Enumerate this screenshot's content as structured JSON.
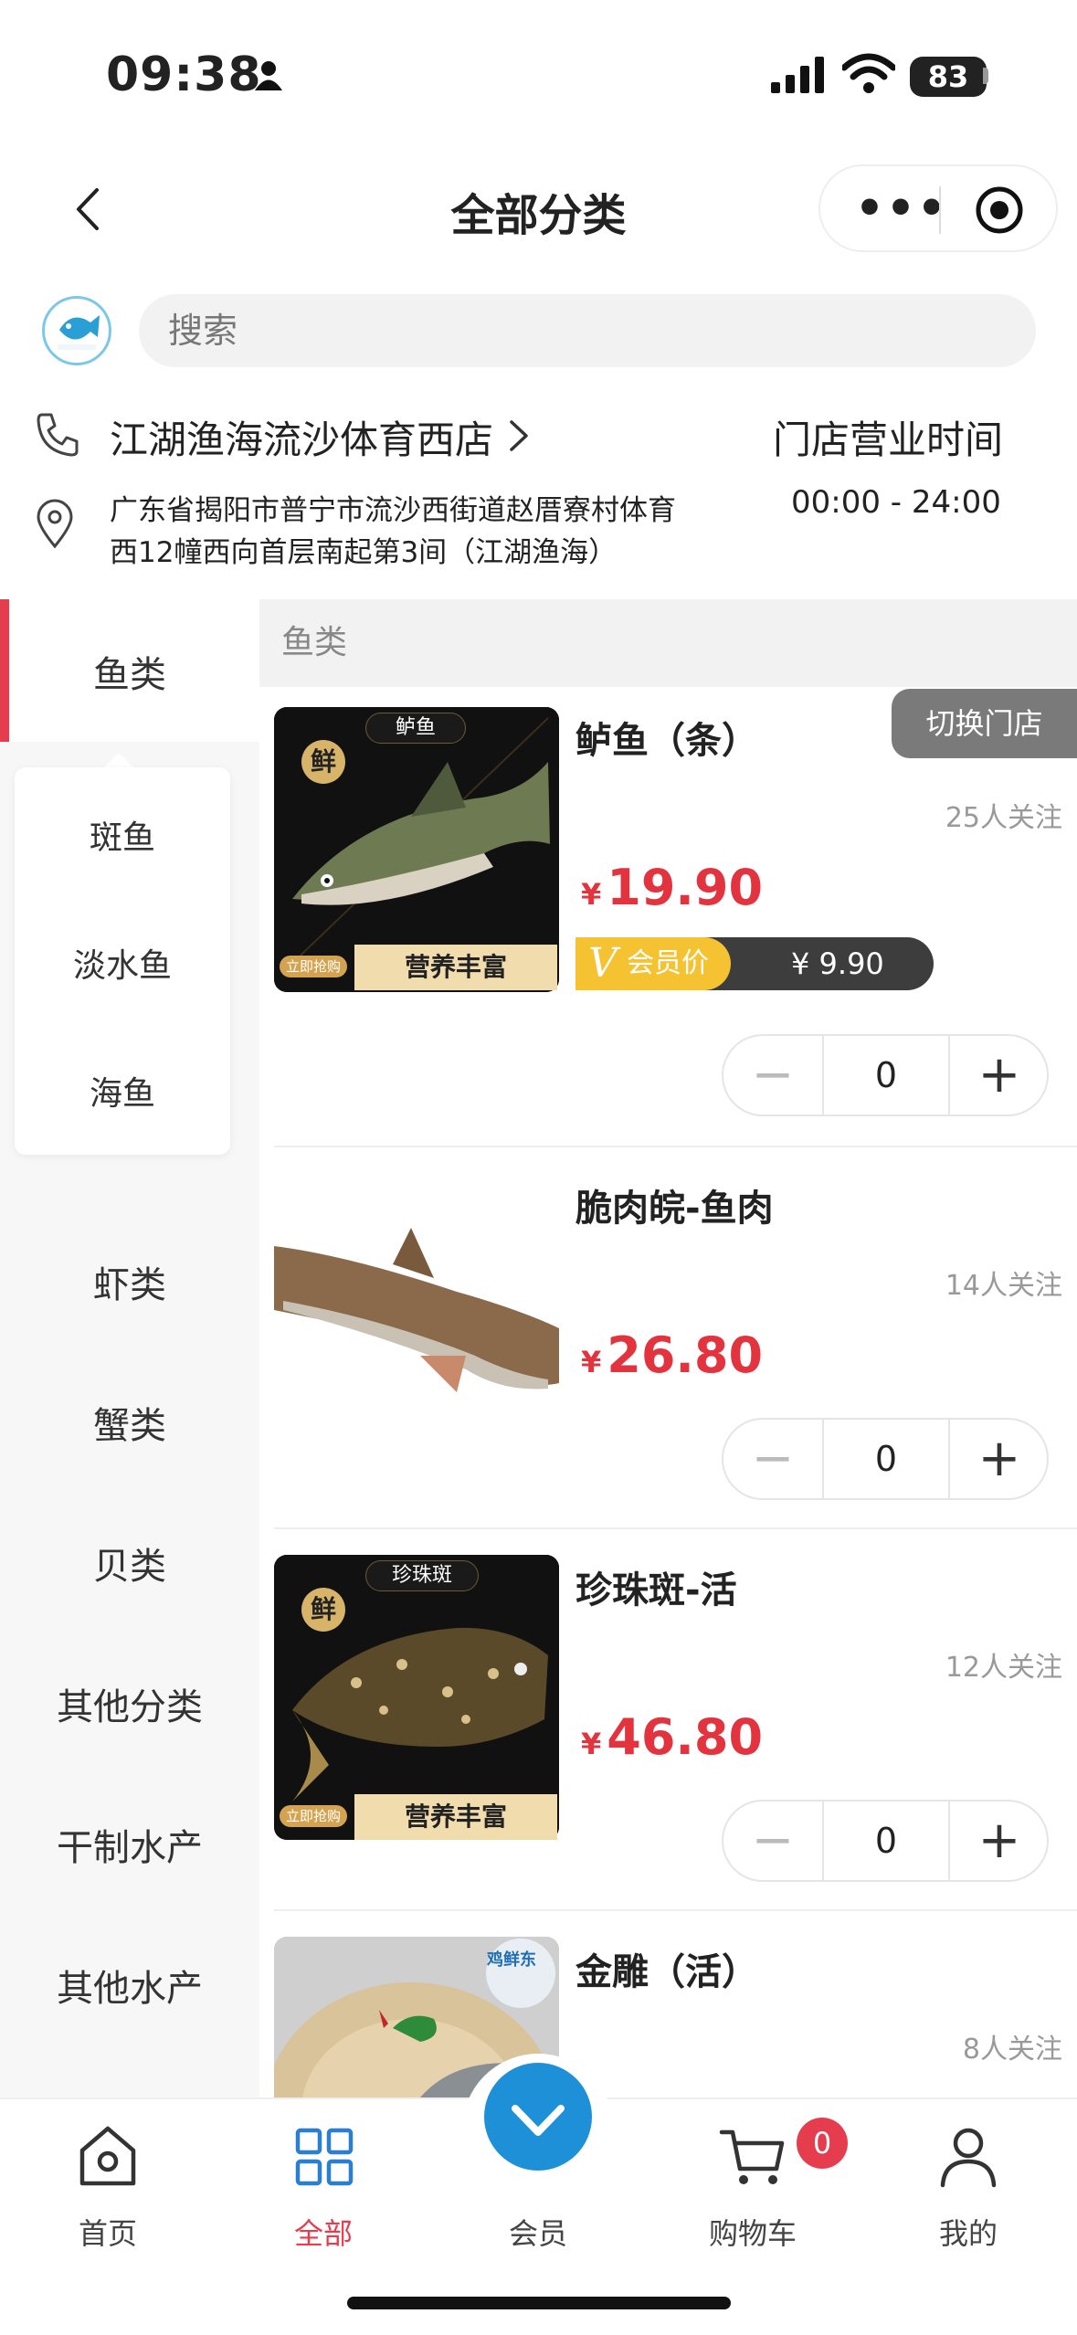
{
  "status": {
    "time": "09:38",
    "battery": "83"
  },
  "nav": {
    "title": "全部分类",
    "more_label": "•••"
  },
  "search": {
    "placeholder": "搜索"
  },
  "store": {
    "name": "江湖渔海流沙体育西店",
    "hours_label": "门店营业时间",
    "hours": "00:00 - 24:00",
    "address": "广东省揭阳市普宁市流沙西街道赵厝寮村体育西12幢西向首层南起第3间（江湖渔海）",
    "switch_label": "切换门店",
    "logo_text": "江湖渔海"
  },
  "sidebar": {
    "active": "鱼类",
    "sub_items": [
      "斑鱼",
      "淡水鱼",
      "海鱼"
    ],
    "items": [
      "虾类",
      "蟹类",
      "贝类",
      "其他分类",
      "干制水产",
      "其他水产"
    ]
  },
  "category_header": "鱼类",
  "products": [
    {
      "name": "鲈鱼（条）",
      "follow": "25人关注",
      "currency": "¥",
      "price": "19.90",
      "quantity": "0",
      "badge_fresh": "鲜",
      "img_tag": "鲈鱼",
      "img_banner": "营养丰富",
      "img_grab": "立即抢购"
    },
    {
      "name": "脆肉皖-鱼肉",
      "follow": "14人关注",
      "currency": "¥",
      "price": "26.80",
      "quantity": "0"
    },
    {
      "name": "珍珠斑-活",
      "follow": "12人关注",
      "currency": "¥",
      "price": "46.80",
      "quantity": "0",
      "badge_fresh": "鲜",
      "img_tag": "珍珠斑",
      "img_banner": "营养丰富",
      "img_grab": "立即抢购"
    },
    {
      "name": "金雕（活）",
      "follow": "8人关注",
      "img_sticker": "鸡鲜东"
    }
  ],
  "vip_price": {
    "v": "V",
    "label": "会员价",
    "price": "¥ 9.90"
  },
  "tabbar": {
    "items": [
      "首页",
      "全部",
      "会员",
      "购物车",
      "我的"
    ],
    "active": "全部",
    "cart_count": "0"
  },
  "colors": {
    "accent": "#e53d4d",
    "price": "#e2333f",
    "vip_gold": "#f5c232",
    "vip_blue": "#1e90d8",
    "active_tab": "#e53d4d"
  }
}
